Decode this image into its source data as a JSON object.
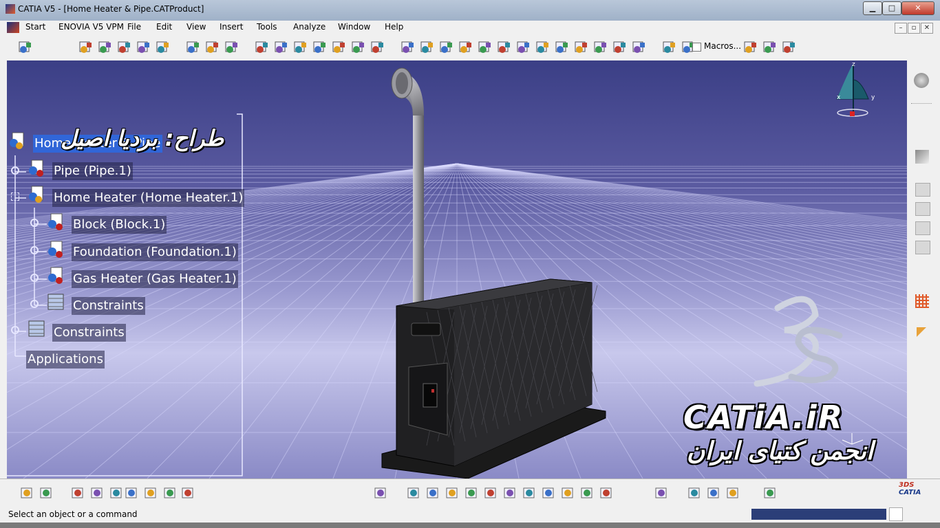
{
  "window": {
    "title": "CATIA V5 - [Home Heater & Pipe.CATProduct]",
    "minimize": "▁",
    "maximize": "□",
    "close": "✕"
  },
  "menu": {
    "items": [
      "Start",
      "ENOVIA V5 VPM",
      "File",
      "Edit",
      "View",
      "Insert",
      "Tools",
      "Analyze",
      "Window",
      "Help"
    ]
  },
  "toolbar": {
    "macros_label": "Macros...",
    "icons": [
      "product-icon",
      "snap-icon",
      "explode-icon",
      "clash-icon",
      "sectioning-icon",
      "measure-icon",
      "catalog-icon",
      "bottle-icon",
      "part-icon",
      "component-icon",
      "fix-icon",
      "constraint-icon",
      "pencil-icon",
      "table-icon",
      "replace-icon",
      "update-icon",
      "multi-instance-icon",
      "gear-icon",
      "assembly-feature-icon",
      "split-icon",
      "hole-icon",
      "pocket-icon",
      "remove-icon",
      "add-icon",
      "symmetry-icon",
      "text-icon",
      "annotation-icon",
      "flag-icon",
      "weld-icon",
      "scene-icon",
      "view-icon",
      "isometric-icon",
      "front-view-icon",
      "document-icon"
    ]
  },
  "tree": {
    "root": "Home Heater & Pipe",
    "nodes": [
      {
        "label": "Pipe (Pipe.1)"
      },
      {
        "label": "Home Heater (Home Heater.1)"
      },
      {
        "label": "Block (Block.1)"
      },
      {
        "label": "Foundation (Foundation.1)"
      },
      {
        "label": "Gas Heater (Gas Heater.1)"
      },
      {
        "label": "Constraints"
      },
      {
        "label": "Constraints"
      },
      {
        "label": "Applications"
      }
    ]
  },
  "watermark": {
    "designer": "طراح: بردیا اصیل",
    "brand": "CATiA.iR",
    "slogan": "انجمن کتیای ایران",
    "logo": "3DS"
  },
  "compass": {
    "axes": [
      "z",
      "x",
      "y"
    ]
  },
  "status": {
    "message": "Select an object or a command"
  },
  "colors": {
    "accent": "#3166d8",
    "viewport_top": "#3b3f86",
    "viewport_bottom": "#c8c8ec",
    "status_field": "#2b3e78"
  }
}
